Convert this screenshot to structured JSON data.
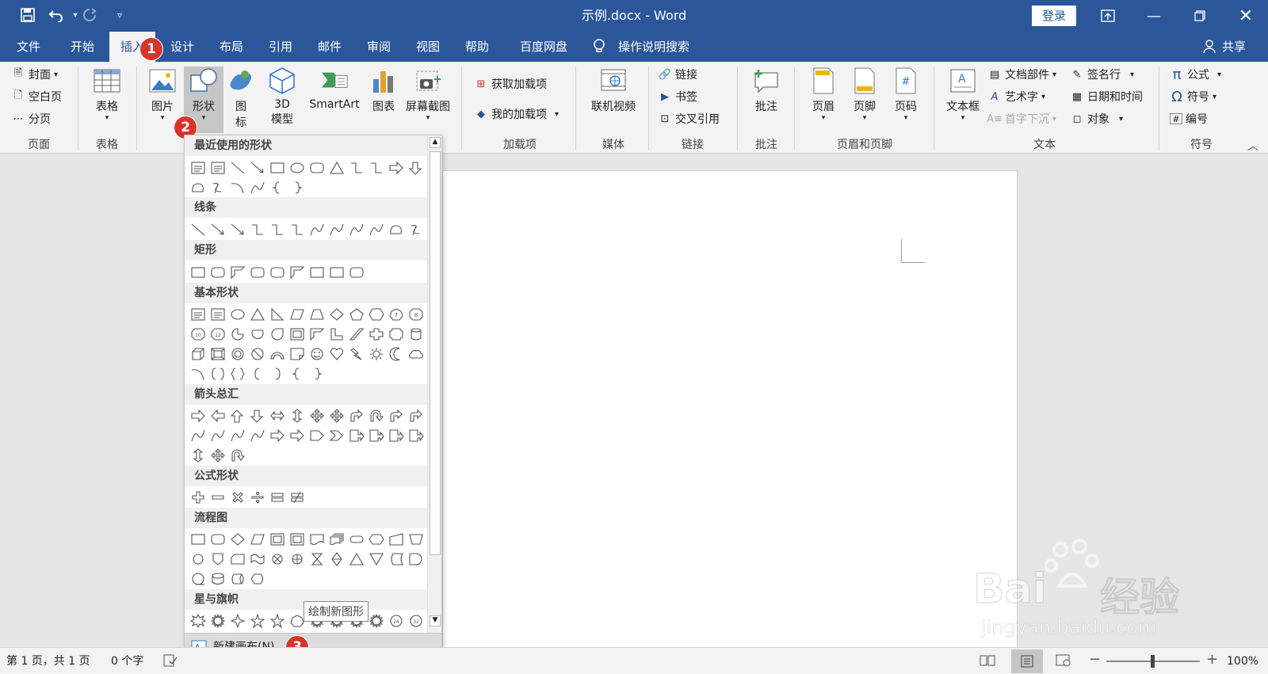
{
  "titlebar": {
    "doc_title": "示例.docx - Word",
    "login_label": "登录"
  },
  "tabs": [
    {
      "label": "文件"
    },
    {
      "label": "开始"
    },
    {
      "label": "插入"
    },
    {
      "label": "设计"
    },
    {
      "label": "布局"
    },
    {
      "label": "引用"
    },
    {
      "label": "邮件"
    },
    {
      "label": "审阅"
    },
    {
      "label": "视图"
    },
    {
      "label": "帮助"
    },
    {
      "label": "百度网盘"
    }
  ],
  "tellme": "操作说明搜索",
  "share": "共享",
  "ribbon": {
    "pages": {
      "cover": "封面",
      "blank": "空白页",
      "break": "分页",
      "group": "页面"
    },
    "table": {
      "label": "表格",
      "group": "表格"
    },
    "illus": {
      "picture": "图片",
      "shapes": "形状",
      "icons_1": "图",
      "icons_2": "标",
      "model_1": "3D",
      "model_2": "模型",
      "smartart": "SmartArt",
      "chart": "图表",
      "screenshot": "屏幕截图"
    },
    "addins": {
      "get": "获取加载项",
      "my": "我的加载项",
      "group": "加载项"
    },
    "media": {
      "video": "联机视频",
      "group": "媒体"
    },
    "links": {
      "link": "链接",
      "bookmark": "书签",
      "xref": "交叉引用",
      "group": "链接"
    },
    "comments": {
      "comment": "批注",
      "group": "批注"
    },
    "hf": {
      "header": "页眉",
      "footer": "页脚",
      "pagenum": "页码",
      "group": "页眉和页脚"
    },
    "text": {
      "textbox": "文本框",
      "quickparts": "文档部件",
      "wordart": "艺术字",
      "dropcap": "首字下沉",
      "sigline": "签名行",
      "datetime": "日期和时间",
      "object": "对象",
      "group": "文本"
    },
    "symbols": {
      "equation": "公式",
      "symbol": "符号",
      "number": "编号",
      "group": "符号"
    }
  },
  "shapes_panel": {
    "sections": [
      "最近使用的形状",
      "线条",
      "矩形",
      "基本形状",
      "箭头总汇",
      "公式形状",
      "流程图",
      "星与旗帜"
    ],
    "new_canvas": "新建画布(N)",
    "tooltip": "绘制新图形"
  },
  "badges": [
    "1",
    "2",
    "3"
  ],
  "status": {
    "page": "第 1 页，共 1 页",
    "words": "0 个字",
    "zoom": "100%"
  },
  "watermark": {
    "brand": "Bai",
    "brand2": "经验",
    "url": "jingyan.baidu.com"
  }
}
